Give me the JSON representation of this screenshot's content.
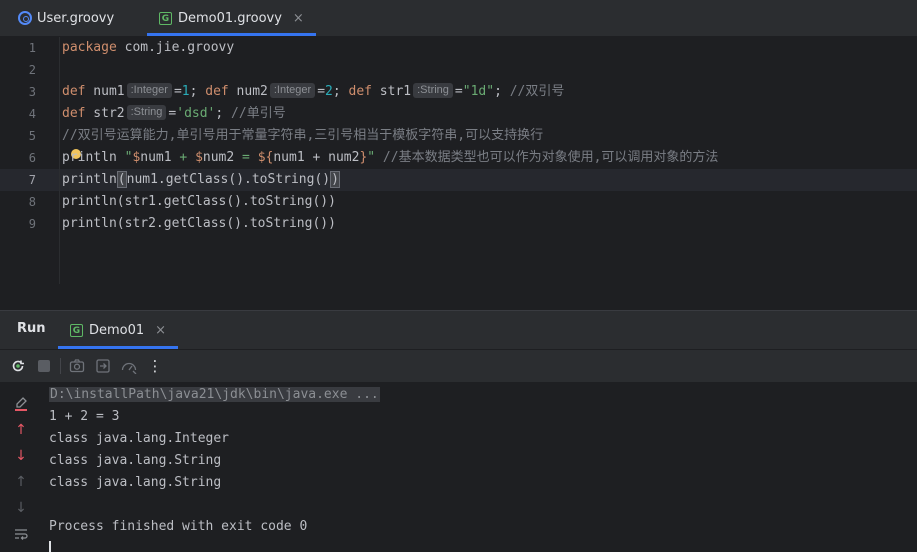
{
  "editor_tabs": [
    {
      "label": "User.groovy",
      "icon": "groovy-class-icon",
      "active": false
    },
    {
      "label": "Demo01.groovy",
      "icon": "groovy-file-icon",
      "active": true,
      "close": "×"
    }
  ],
  "editor": {
    "line_numbers": [
      "1",
      "2",
      "3",
      "4",
      "5",
      "6",
      "7",
      "8",
      "9"
    ],
    "current_line": 7,
    "lines": {
      "l1": {
        "kw": "package",
        "rest": " com.jie.groovy"
      },
      "l3": {
        "def1": "def",
        "var1": " num1",
        "hint1": ":Integer",
        "eq1": "=",
        "n1": "1",
        "semi1": "; ",
        "def2": "def",
        "var2": " num2",
        "hint2": ":Integer",
        "eq2": "=",
        "n2": "2",
        "semi2": "; ",
        "def3": "def",
        "var3": " str1",
        "hint3": ":String",
        "eq3": "=",
        "s3": "\"1d\"",
        "semi3": "; ",
        "cmt": "//双引号"
      },
      "l4": {
        "def": "def",
        "var": " str2",
        "hint": ":String",
        "eq": "=",
        "s": "'dsd'",
        "semi": "; ",
        "cmt": "//单引号"
      },
      "l5": {
        "cmt": "//双引号运算能力,单引号用于常量字符串,三引号相当于模板字符串,可以支持换行"
      },
      "l6": {
        "fn": "println ",
        "q1": "\"",
        "d1": "$",
        "v1": "num1",
        "plus": " + ",
        "d2": "$",
        "v2": "num2",
        "eqs": " = ",
        "d3": "${",
        "expr": "num1 + num2",
        "close": "}",
        "q2": "\"",
        "cmt": " //基本数据类型也可以作为对象使用,可以调用对象的方法"
      },
      "l7": {
        "fn": "println",
        "open": "(",
        "body": "num1.getClass().toString()",
        "close": ")"
      },
      "l8": {
        "text": "println(str1.getClass().toString())"
      },
      "l9": {
        "text": "println(str2.getClass().toString())"
      }
    }
  },
  "run_window": {
    "title": "Run",
    "tab": {
      "label": "Demo01",
      "close": "×"
    },
    "toolbar": [
      "rerun-icon",
      "stop-icon",
      "screenshot-icon",
      "export-icon",
      "profile-icon",
      "more-icon"
    ],
    "more_label": "⋮",
    "console": [
      "D:\\installPath\\java21\\jdk\\bin\\java.exe ...",
      "1 + 2 = 3",
      "class java.lang.Integer",
      "class java.lang.String",
      "class java.lang.String",
      "",
      "Process finished with exit code 0"
    ]
  },
  "colors": {
    "background": "#1e1f22",
    "panel": "#2b2d30",
    "accent": "#3574f0",
    "keyword": "#cf8e6d",
    "number": "#2aacb8",
    "string": "#6aab73",
    "comment": "#7a7e85",
    "error_red": "#e55765"
  }
}
